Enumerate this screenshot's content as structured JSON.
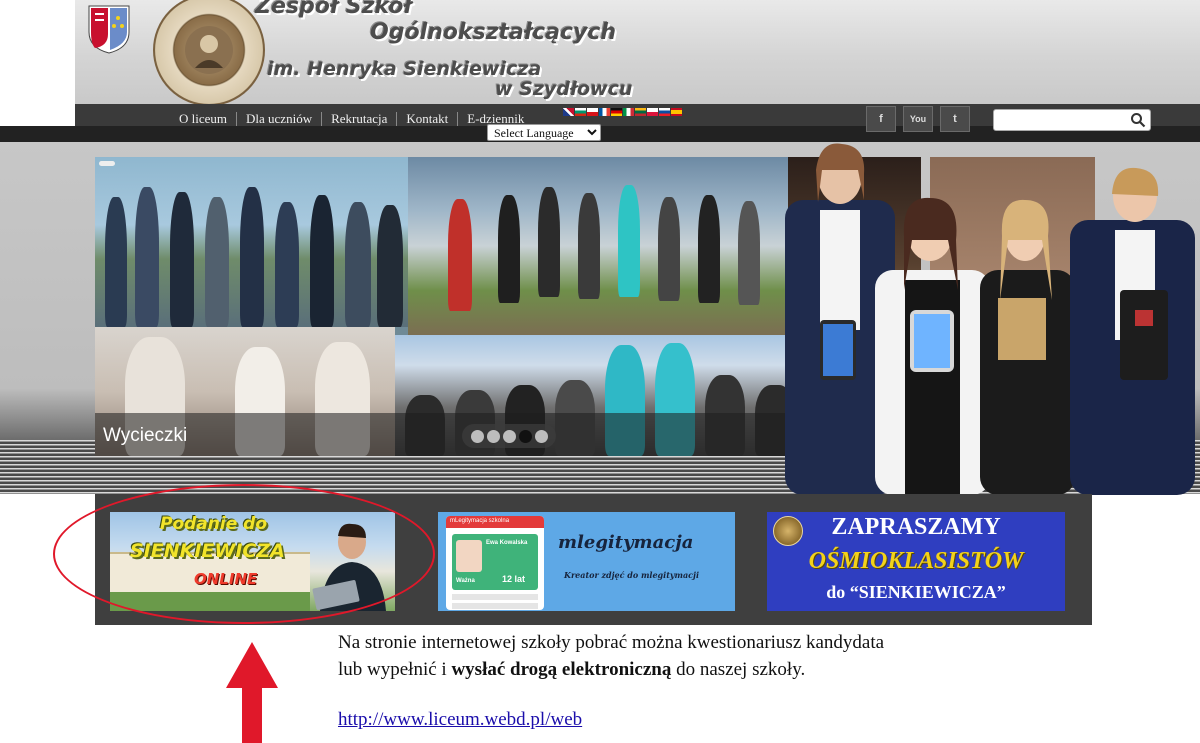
{
  "header": {
    "title_line1": "Zespół Szkół",
    "title_line2": "Ogólnokształcących",
    "title_line3": "im. Henryka Sienkiewicza",
    "title_line4": "w Szydłowcu"
  },
  "nav": {
    "items": [
      "O liceum",
      "Dla uczniów",
      "Rekrutacja",
      "Kontakt",
      "E-dziennik"
    ],
    "language_select": "Select Language",
    "flags": [
      "#1e3a8a",
      "#e8e8e8",
      "#c8102e",
      "#ffffff",
      "#111111",
      "#009246",
      "#d52b1e",
      "#0055a4",
      "#ffcc00",
      "#d52b1e"
    ]
  },
  "social": {
    "youtube_label": "You",
    "facebook_label": "f",
    "twitter_label": "t"
  },
  "slider": {
    "caption": "Wycieczki",
    "dots": 5,
    "active_dot": 4
  },
  "banners": {
    "podanie": {
      "line1": "Podanie do",
      "line2": "SIENKIEWICZA",
      "line3": "ONLINE"
    },
    "mlegitymacja": {
      "card_header": "mLegitymacja szkolna",
      "card_name": "Ewa Kowalska",
      "card_age": "12 lat",
      "card_status": "Ważna",
      "title": "mlegitymacja",
      "subtitle": "Kreator zdjęć do mlegitymacji"
    },
    "zapraszamy": {
      "line1": "ZAPRASZAMY",
      "line2": "OŚMIOKLASISTÓW",
      "line3": "do “SIENKIEWICZA”"
    }
  },
  "info": {
    "line1": "Na stronie internetowej szkoły pobrać można kwestionariusz kandydata",
    "line2_pre": " lub wypełnić i ",
    "line2_bold": "wysłać drogą elektroniczną",
    "line2_post": " do naszej szkoły.",
    "link": "http://www.liceum.webd.pl/web"
  },
  "colors": {
    "annotation_red": "#e0182a",
    "nav_bg": "#3a3a3a",
    "banner_blue": "#2f3ec0"
  }
}
